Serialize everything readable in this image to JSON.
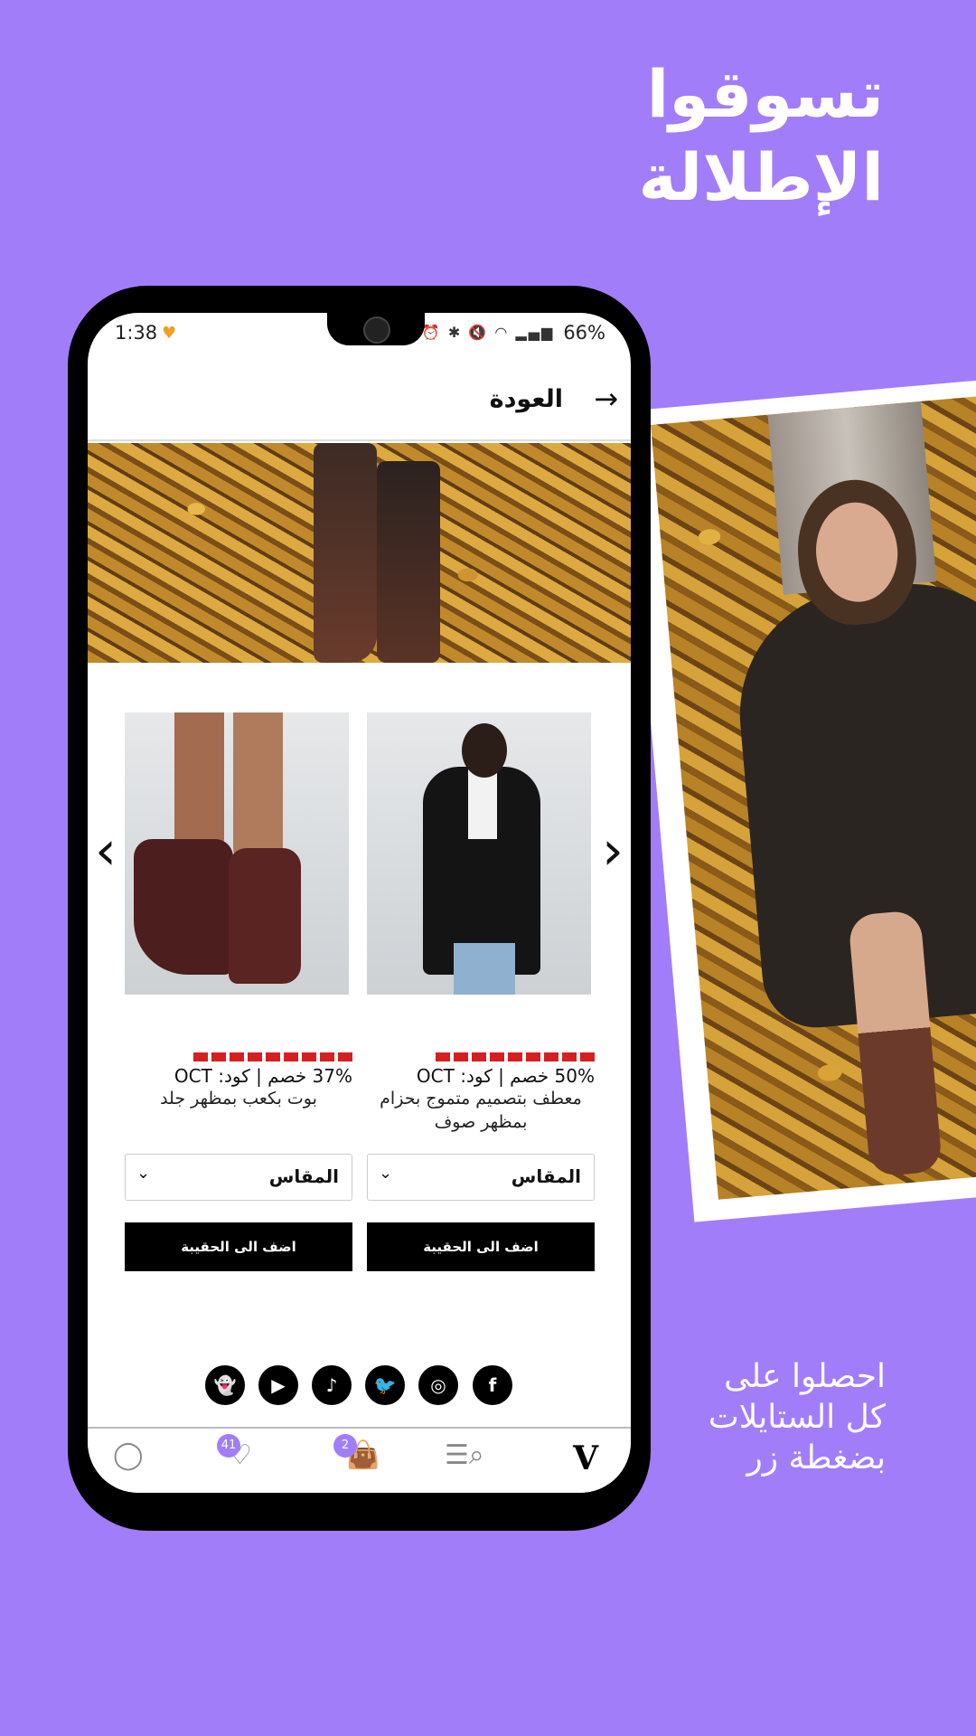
{
  "promo": {
    "headline_line1": "تسوقوا",
    "headline_line2": "الإطلالة",
    "sub_line1": "احصلوا على",
    "sub_line2": "كل الستايلات",
    "sub_line3": "بضغطة زر",
    "background_color": "#a27dfa"
  },
  "status_bar": {
    "time": "1:38",
    "battery": "66%",
    "icons": [
      "notification-icon",
      "alarm-icon",
      "bluetooth-icon",
      "mute-icon",
      "wifi-icon",
      "signal-icon",
      "battery-icon"
    ]
  },
  "header": {
    "back_label": "العودة",
    "back_icon": "arrow-right-icon"
  },
  "carousel": {
    "prev_icon": "chevron-left-icon",
    "next_icon": "chevron-right-icon",
    "products": [
      {
        "discount": "37% خصم | كود: OCT",
        "title": "بوت بكعب بمظهر جلد",
        "size_label": "المقاس",
        "add_button": "اضف الى الحقيبة"
      },
      {
        "discount": "50% خصم | كود: OCT",
        "title": "معطف بتصميم متموج بحزام بمظهر صوف",
        "size_label": "المقاس",
        "add_button": "اضف الى الحقيبة"
      }
    ]
  },
  "socials": [
    "snapchat-icon",
    "youtube-icon",
    "tiktok-icon",
    "twitter-icon",
    "instagram-icon",
    "facebook-icon"
  ],
  "bottom_nav": {
    "wishlist_count": "41",
    "bag_count": "2",
    "logo": "V"
  }
}
